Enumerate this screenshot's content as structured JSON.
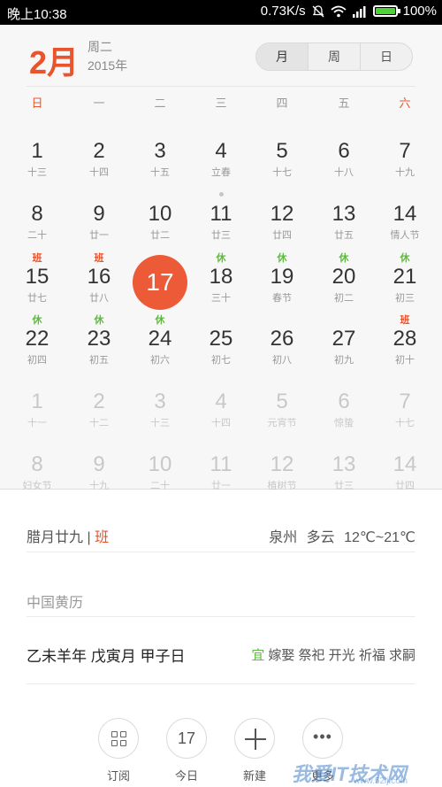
{
  "status_bar": {
    "time": "晚上10:38",
    "speed": "0.73K/s",
    "battery": "100%",
    "battery_level": 1.0,
    "icons": [
      "mute-bell-icon",
      "wifi-icon",
      "signal-icon",
      "battery-icon"
    ]
  },
  "header": {
    "month": "2月",
    "weekday": "周二",
    "year": "2015年",
    "view_tabs": [
      "月",
      "周",
      "日"
    ],
    "active_tab": "月"
  },
  "weekdays": [
    "日",
    "一",
    "二",
    "三",
    "四",
    "五",
    "六"
  ],
  "weeks": [
    [
      {
        "d": "1",
        "l": "十三"
      },
      {
        "d": "2",
        "l": "十四"
      },
      {
        "d": "3",
        "l": "十五"
      },
      {
        "d": "4",
        "l": "立春"
      },
      {
        "d": "5",
        "l": "十七"
      },
      {
        "d": "6",
        "l": "十八"
      },
      {
        "d": "7",
        "l": "十九"
      }
    ],
    [
      {
        "d": "8",
        "l": "二十"
      },
      {
        "d": "9",
        "l": "廿一"
      },
      {
        "d": "10",
        "l": "廿二"
      },
      {
        "d": "11",
        "l": "廿三",
        "dot": true
      },
      {
        "d": "12",
        "l": "廿四"
      },
      {
        "d": "13",
        "l": "廿五"
      },
      {
        "d": "14",
        "l": "情人节"
      }
    ],
    [
      {
        "d": "15",
        "l": "廿七",
        "tag": "班",
        "tagType": "work"
      },
      {
        "d": "16",
        "l": "廿八",
        "tag": "班",
        "tagType": "work"
      },
      {
        "d": "17",
        "l": "",
        "selected": true
      },
      {
        "d": "18",
        "l": "三十",
        "tag": "休",
        "tagType": "rest"
      },
      {
        "d": "19",
        "l": "春节",
        "tag": "休",
        "tagType": "rest"
      },
      {
        "d": "20",
        "l": "初二",
        "tag": "休",
        "tagType": "rest"
      },
      {
        "d": "21",
        "l": "初三",
        "tag": "休",
        "tagType": "rest"
      }
    ],
    [
      {
        "d": "22",
        "l": "初四",
        "tag": "休",
        "tagType": "rest"
      },
      {
        "d": "23",
        "l": "初五",
        "tag": "休",
        "tagType": "rest"
      },
      {
        "d": "24",
        "l": "初六",
        "tag": "休",
        "tagType": "rest"
      },
      {
        "d": "25",
        "l": "初七"
      },
      {
        "d": "26",
        "l": "初八"
      },
      {
        "d": "27",
        "l": "初九"
      },
      {
        "d": "28",
        "l": "初十",
        "tag": "班",
        "tagType": "work"
      }
    ],
    [
      {
        "d": "1",
        "l": "十一",
        "faded": true
      },
      {
        "d": "2",
        "l": "十二",
        "faded": true
      },
      {
        "d": "3",
        "l": "十三",
        "faded": true
      },
      {
        "d": "4",
        "l": "十四",
        "faded": true
      },
      {
        "d": "5",
        "l": "元宵节",
        "faded": true
      },
      {
        "d": "6",
        "l": "惊蛰",
        "faded": true
      },
      {
        "d": "7",
        "l": "十七",
        "faded": true
      }
    ],
    [
      {
        "d": "8",
        "l": "妇女节",
        "faded": true
      },
      {
        "d": "9",
        "l": "十九",
        "faded": true
      },
      {
        "d": "10",
        "l": "二十",
        "faded": true
      },
      {
        "d": "11",
        "l": "廿一",
        "faded": true
      },
      {
        "d": "12",
        "l": "植树节",
        "faded": true
      },
      {
        "d": "13",
        "l": "廿三",
        "faded": true
      },
      {
        "d": "14",
        "l": "廿四",
        "faded": true
      }
    ]
  ],
  "info": {
    "lunar_date": "腊月廿九",
    "separator": "|",
    "work_tag": "班",
    "weather": "泉州 多云 12℃~21℃",
    "almanac_title": "中国黄历",
    "ganzhi": "乙未羊年 戊寅月 甲子日",
    "yi_label": "宜",
    "yi_items": "嫁娶 祭祀 开光 祈福 求嗣"
  },
  "actions": [
    {
      "label": "订阅",
      "icon": "grid-icon"
    },
    {
      "label": "今日",
      "icon": "today-icon",
      "value": "17"
    },
    {
      "label": "新建",
      "icon": "plus-icon"
    },
    {
      "label": "更多",
      "icon": "more-icon"
    }
  ],
  "watermark": {
    "text": "我爱IT技术网",
    "url": "www.52ij.com"
  },
  "colors": {
    "accent": "#ec5a37",
    "rest": "#5dbb3d",
    "background": "#f7f7f7"
  }
}
